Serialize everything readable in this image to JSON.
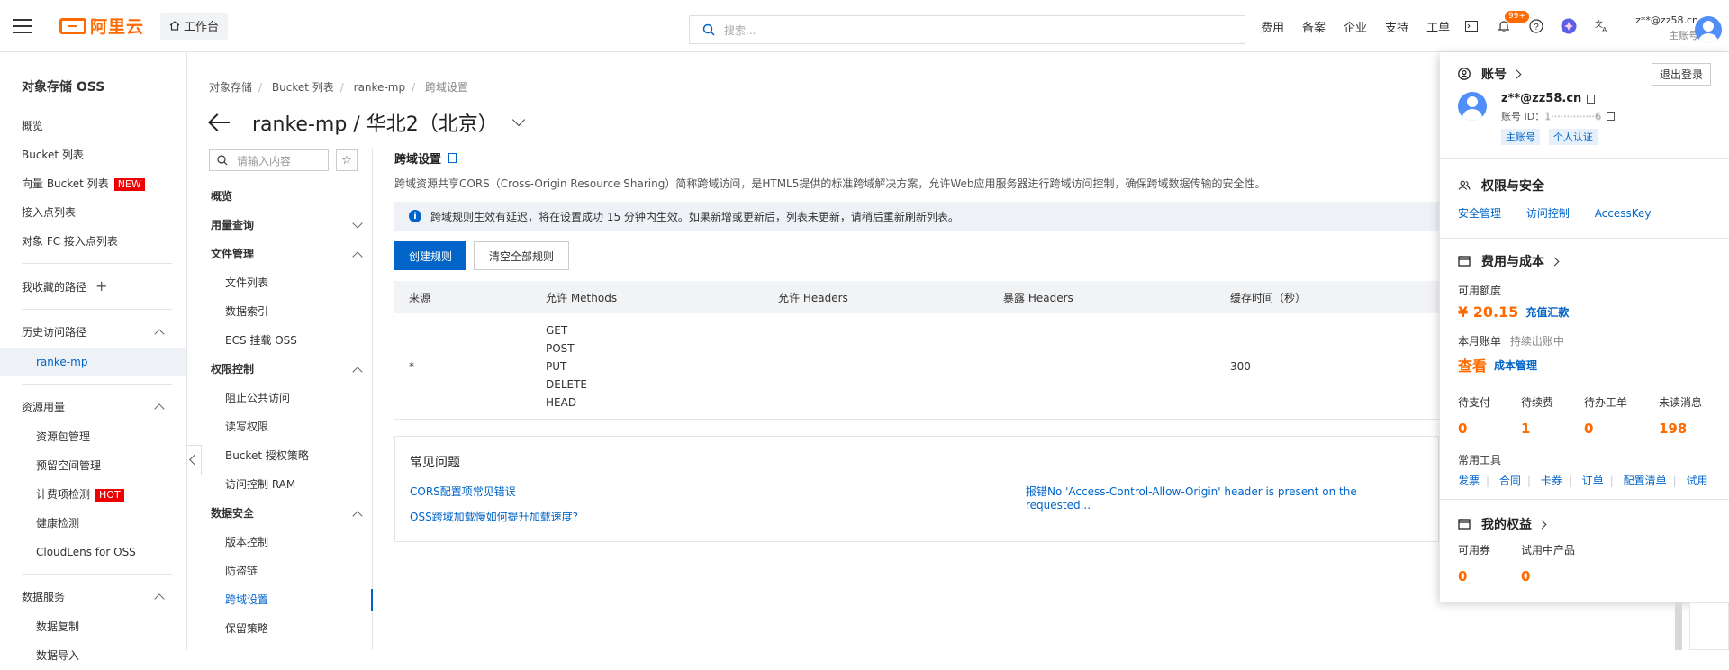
{
  "topbar": {
    "logo_text": "阿里云",
    "workbench_label": "工作台",
    "search_placeholder": "搜索...",
    "links": [
      "费用",
      "备案",
      "企业",
      "支持",
      "工单"
    ],
    "notification_badge": "99+",
    "user_name": "z**@zz58.cn",
    "user_type": "主账号"
  },
  "sidebar": {
    "title": "对象存储 OSS",
    "items": [
      "概览",
      "Bucket 列表",
      "向量 Bucket 列表",
      "接入点列表",
      "对象 FC 接入点列表"
    ],
    "new_tag": "NEW",
    "favorites_label": "我收藏的路径",
    "history_label": "历史访问路径",
    "history_items": [
      "ranke-mp"
    ],
    "resource_label": "资源用量",
    "resource_items": [
      "资源包管理",
      "预留空间管理",
      "计费项检测",
      "健康检测",
      "CloudLens for OSS"
    ],
    "hot_tag": "HOT",
    "data_service_label": "数据服务",
    "data_service_items": [
      "数据复制",
      "数据导入"
    ]
  },
  "breadcrumb": [
    "对象存储",
    "Bucket 列表",
    "ranke-mp",
    "跨域设置"
  ],
  "page_title": "ranke-mp / 华北2（北京）",
  "subnav": {
    "search_placeholder": "请输入内容",
    "overview": "概览",
    "usage": "用量查询",
    "file_mgmt": "文件管理",
    "file_items": [
      "文件列表",
      "数据索引",
      "ECS 挂载 OSS"
    ],
    "perm": "权限控制",
    "perm_items": [
      "阻止公共访问",
      "读写权限",
      "Bucket 授权策略",
      "访问控制 RAM"
    ],
    "security": "数据安全",
    "security_items": [
      "版本控制",
      "防盗链",
      "跨域设置",
      "保留策略"
    ]
  },
  "main": {
    "section_title": "跨域设置",
    "description": "跨域资源共享CORS（Cross-Origin Resource Sharing）简称跨域访问，是HTML5提供的标准跨域解决方案，允许Web应用服务器进行跨域访问控制，确保跨域数据传输的安全性。",
    "notice": "跨域规则生效有延迟，将在设置成功 15 分钟内生效。如果新增或更新后，列表未更新，请稍后重新刷新列表。",
    "create_button": "创建规则",
    "clear_button": "清空全部规则",
    "table": {
      "headers": [
        "来源",
        "允许 Methods",
        "允许 Headers",
        "暴露 Headers",
        "缓存时间（秒）"
      ],
      "row": {
        "origin": "*",
        "methods": [
          "GET",
          "POST",
          "PUT",
          "DELETE",
          "HEAD"
        ],
        "allow_headers": "",
        "expose_headers": "",
        "max_age": "300"
      }
    },
    "faq": {
      "title": "常见问题",
      "links": [
        "CORS配置项常见错误",
        "报错No 'Access-Control-Allow-Origin' header is present on the requested...",
        "OSS跨域加载慢如何提升加载速度?"
      ]
    }
  },
  "account_panel": {
    "account_label": "账号",
    "logout": "退出登录",
    "email": "z**@zz58.cn",
    "account_id_label": "账号 ID：",
    "account_id": "1··············6",
    "tags": [
      "主账号",
      "个人认证"
    ],
    "security_label": "权限与安全",
    "security_links": [
      "安全管理",
      "访问控制",
      "AccessKey"
    ],
    "cost_label": "费用与成本",
    "available_label": "可用额度",
    "balance": "¥ 20.15",
    "recharge": "充值汇款",
    "bill_label": "本月账单",
    "bill_status": "持续出账中",
    "view": "查看",
    "cost_mgmt": "成本管理",
    "stats": [
      {
        "label": "待支付",
        "value": "0"
      },
      {
        "label": "待续费",
        "value": "1"
      },
      {
        "label": "待办工单",
        "value": "0"
      },
      {
        "label": "未读消息",
        "value": "198"
      }
    ],
    "tools_label": "常用工具",
    "tools": [
      "发票",
      "合同",
      "卡券",
      "订单",
      "配置清单",
      "试用"
    ],
    "benefits_label": "我的权益",
    "benefits": [
      {
        "label": "可用券",
        "value": "0"
      },
      {
        "label": "试用中产品",
        "value": "0"
      }
    ]
  },
  "colors": {
    "brand": "#ff6a00",
    "primary": "#0064c8",
    "badge": "#ff6a00",
    "tag_red": "#e00000"
  }
}
